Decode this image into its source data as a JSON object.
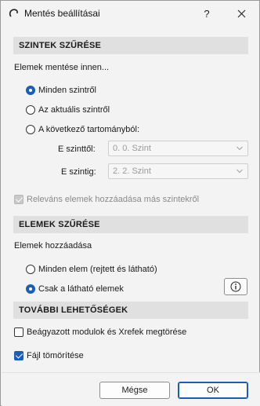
{
  "window": {
    "title": "Mentés beállításai",
    "help_label": "?",
    "close_label": "✕"
  },
  "levels_filter": {
    "header": "SZINTEK SZŰRÉSE",
    "save_from_label": "Elemek mentése innen...",
    "options": [
      {
        "label": "Minden szintről",
        "checked": true
      },
      {
        "label": "Az aktuális szintről",
        "checked": false
      },
      {
        "label": "A következő tartományból:",
        "checked": false
      }
    ],
    "from_label": "E szinttől:",
    "from_value": "0. 0. Szint",
    "to_label": "E szintig:",
    "to_value": "2. 2. Szint",
    "relevant_label": "Releváns elemek hozzáadása más szintekről",
    "relevant_checked": true
  },
  "elements_filter": {
    "header": "ELEMEK SZŰRÉSE",
    "add_label": "Elemek hozzáadása",
    "options": [
      {
        "label": "Minden elem (rejtett és látható)",
        "checked": false
      },
      {
        "label": "Csak a látható elemek",
        "checked": true
      }
    ]
  },
  "more_options": {
    "header": "TOVÁBBI LEHETŐSÉGEK",
    "break_modules_label": "Beágyazott modulok és Xrefek megtörése",
    "break_modules_checked": false,
    "compress_label": "Fájl tömörítése",
    "compress_checked": true
  },
  "buttons": {
    "cancel": "Mégse",
    "ok": "OK"
  },
  "colors": {
    "accent": "#1a5fb4",
    "section_bg": "#e0e0e0",
    "window_bg": "#f3f3f3"
  }
}
